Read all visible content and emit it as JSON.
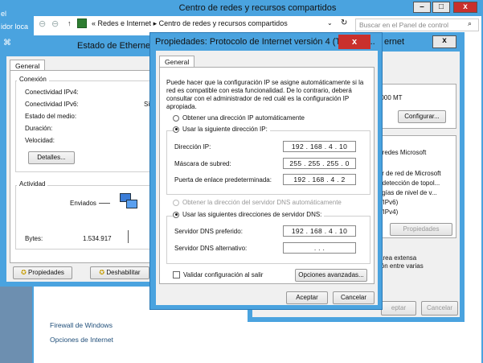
{
  "main_window": {
    "title": "Centro de redes y recursos compartidos",
    "min": "–",
    "max": "□",
    "close": "x",
    "crumb_1": "« Redes e Internet",
    "crumb_sep": "▸",
    "crumb_2": "Centro de redes y recursos compartidos",
    "search_placeholder": "Buscar en el Panel de control",
    "link_firewall": "Firewall de Windows",
    "link_options": "Opciones de Internet"
  },
  "left_fragment": {
    "line1": "el",
    "line2": "idor loca"
  },
  "ethernet_status": {
    "title": "Estado de Ethernet",
    "tab": "General",
    "conexion": "Conexión",
    "ipv4": "Conectividad IPv4:",
    "ipv6": "Conectividad IPv6:",
    "ipv6_value": "Sin",
    "medio": "Estado del medio:",
    "duracion": "Duración:",
    "velocidad": "Velocidad:",
    "detalles": "Detalles...",
    "actividad": "Actividad",
    "enviados": "Enviados",
    "bytes": "Bytes:",
    "bytes_value": "1.534.917",
    "propiedades": "Propiedades",
    "deshabilitar": "Deshabilitar"
  },
  "right_window": {
    "title": "ernet",
    "close": "x",
    "speed": "1000 MT",
    "configurar": "Configurar...",
    "item1": "a redes Microsoft",
    "item2": "lor de red de Microsoft",
    "item3": "e detección de topol...",
    "item4": "logías de nivel de v...",
    "item5": "P/IPv6)",
    "item6": "P/IPv4)",
    "propiedades": "Propiedades",
    "desc1": "área extensa",
    "desc2": "ión entre varias",
    "aceptar": "eptar",
    "cancelar": "Cancelar"
  },
  "dialog": {
    "title": "Propiedades: Protocolo de Internet versión 4 (TCP/IPv...",
    "close": "x",
    "tab": "General",
    "intro": "Puede hacer que la configuración IP se asigne automáticamente si la red es compatible con esta funcionalidad. De lo contrario, deberá consultar con el administrador de red cuál es la configuración IP apropiada.",
    "auto_ip": "Obtener una dirección IP automáticamente",
    "manual_ip": "Usar la siguiente dirección IP:",
    "ip_label": "Dirección IP:",
    "ip_value": "192 . 168 . 4 . 10",
    "mask_label": "Máscara de subred:",
    "mask_value": "255 . 255 . 255 . 0",
    "gw_label": "Puerta de enlace predeterminada:",
    "gw_value": "192 . 168 . 4 . 2",
    "auto_dns": "Obtener la dirección del servidor DNS automáticamente",
    "manual_dns": "Usar las siguientes direcciones de servidor DNS:",
    "dns1_label": "Servidor DNS preferido:",
    "dns1_value": "192 . 168 . 4 . 10",
    "dns2_label": "Servidor DNS alternativo:",
    "dns2_value": ".     .     .",
    "validate": "Validar configuración al salir",
    "advanced": "Opciones avanzadas...",
    "ok": "Aceptar",
    "cancel": "Cancelar"
  }
}
